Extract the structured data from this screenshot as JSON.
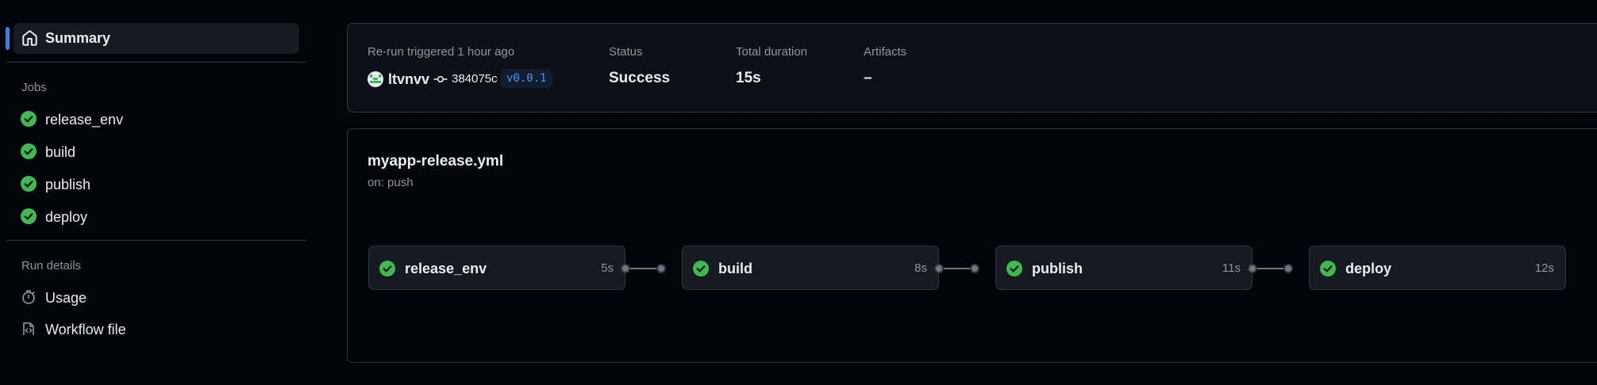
{
  "sidebar": {
    "summary_label": "Summary",
    "jobs_heading": "Jobs",
    "jobs": [
      {
        "label": "release_env",
        "icon": "check-circle-icon"
      },
      {
        "label": "build",
        "icon": "check-circle-icon"
      },
      {
        "label": "publish",
        "icon": "check-circle-icon"
      },
      {
        "label": "deploy",
        "icon": "check-circle-icon"
      }
    ],
    "run_details_heading": "Run details",
    "run_details": [
      {
        "label": "Usage",
        "icon": "stopwatch-icon"
      },
      {
        "label": "Workflow file",
        "icon": "file-code-icon"
      }
    ]
  },
  "summary": {
    "trigger_label": "Re-run triggered 1 hour ago",
    "actor": "ltvnvv",
    "commit": "384075c",
    "tag": "v0.0.1",
    "status_label": "Status",
    "status_value": "Success",
    "duration_label": "Total duration",
    "duration_value": "15s",
    "artifacts_label": "Artifacts",
    "artifacts_value": "–"
  },
  "workflow": {
    "filename": "myapp-release.yml",
    "trigger": "on: push",
    "jobs": [
      {
        "name": "release_env",
        "duration": "5s"
      },
      {
        "name": "build",
        "duration": "8s"
      },
      {
        "name": "publish",
        "duration": "11s"
      },
      {
        "name": "deploy",
        "duration": "12s"
      }
    ]
  },
  "colors": {
    "background": "#010409",
    "panel": "#0d1117",
    "border": "#30363d",
    "accent": "#2f81f7",
    "success": "#3fb950",
    "muted_text": "#8d96a0"
  }
}
